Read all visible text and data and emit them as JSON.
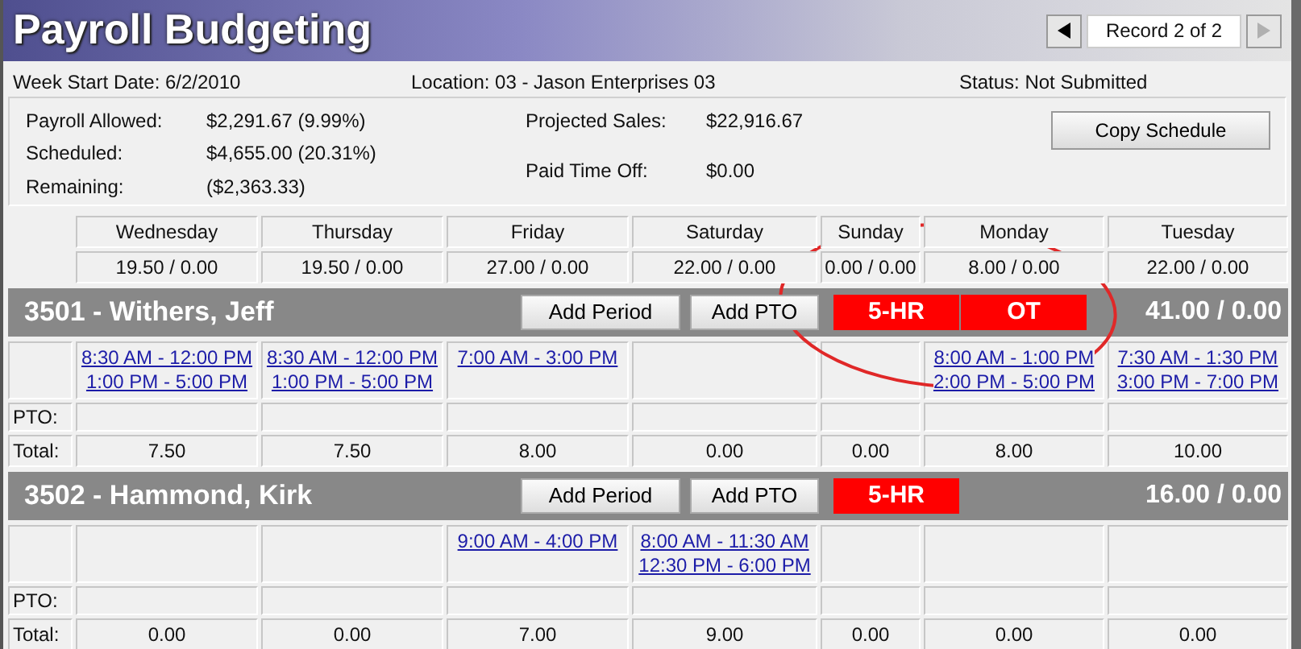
{
  "title": "Payroll Budgeting",
  "navigation": {
    "label": "Record 2 of 2",
    "previous_disabled": false,
    "next_disabled": true
  },
  "header_info": [
    "Week Start Date: 6/2/2010",
    "Location: 03 - Jason Enterprises 03",
    "Status: Not Submitted"
  ],
  "summary": {
    "left": [
      {
        "label": "Payroll Allowed:",
        "value": "$2,291.67 (9.99%)"
      },
      {
        "label": "Scheduled:",
        "value": "$4,655.00 (20.31%)"
      },
      {
        "label": "Remaining:",
        "value": "($2,363.33)"
      }
    ],
    "right": [
      {
        "label": "Projected Sales:",
        "value": "$22,916.67"
      },
      {
        "label": "Paid Time Off:",
        "value": "$0.00"
      }
    ],
    "button": "Copy Schedule"
  },
  "days": [
    {
      "name": "Wednesday",
      "hours": "19.50 / 0.00"
    },
    {
      "name": "Thursday",
      "hours": "19.50 / 0.00"
    },
    {
      "name": "Friday",
      "hours": "27.00 / 0.00"
    },
    {
      "name": "Saturday",
      "hours": "22.00 / 0.00"
    },
    {
      "name": "Sunday",
      "hours": "0.00 / 0.00"
    },
    {
      "name": "Monday",
      "hours": "8.00 / 0.00"
    },
    {
      "name": "Tuesday",
      "hours": "22.00 / 0.00"
    }
  ],
  "employees": [
    {
      "name": "3501 - Withers, Jeff",
      "buttons": [
        "Add Period",
        "Add PTO"
      ],
      "flags": [
        "5-HR",
        "OT"
      ],
      "total": "41.00 / 0.00",
      "shifts": {
        "wednesday": [
          "8:30 AM - 12:00 PM",
          "1:00 PM - 5:00 PM"
        ],
        "thursday": [
          "8:30 AM - 12:00 PM",
          "1:00 PM - 5:00 PM"
        ],
        "friday": [
          "7:00 AM - 3:00 PM"
        ],
        "monday": [
          "8:00 AM - 1:00 PM",
          "2:00 PM - 5:00 PM"
        ],
        "tuesday": [
          "7:30 AM - 1:30 PM",
          "3:00 PM - 7:00 PM"
        ]
      },
      "pto_label": "PTO:",
      "total_label": "Total:",
      "day_totals": [
        "7.50",
        "7.50",
        "8.00",
        "0.00",
        "0.00",
        "8.00",
        "10.00"
      ]
    },
    {
      "name": "3502 - Hammond, Kirk",
      "buttons": [
        "Add Period",
        "Add PTO"
      ],
      "flags": [
        "5-HR"
      ],
      "total": "16.00 / 0.00",
      "shifts": {
        "friday": [
          "9:00 AM - 4:00 PM"
        ],
        "saturday": [
          "8:00 AM - 11:30 AM",
          "12:30 PM - 6:00 PM"
        ]
      },
      "pto_label": "PTO:",
      "total_label": "Total:",
      "day_totals": [
        "0.00",
        "0.00",
        "7.00",
        "9.00",
        "0.00",
        "0.00",
        "0.00"
      ]
    }
  ],
  "annotation": {
    "color": "#e02828"
  }
}
